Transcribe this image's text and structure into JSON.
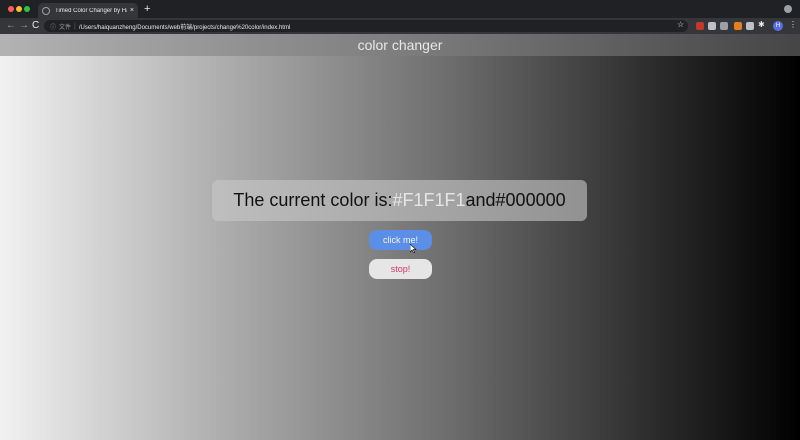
{
  "browser": {
    "tab_title": "Timed Color Changer by Haiq...",
    "tab_close": "×",
    "new_tab": "+",
    "nav": {
      "back": "←",
      "forward": "→",
      "reload": "C"
    },
    "omnibox": {
      "info_icon": "ⓘ",
      "scheme_label": "文件",
      "url": "/Users/haiquanzheng/Documents/web前端/projects/change%20color/index.html"
    },
    "icons": {
      "star": "☆",
      "puzzle": "✱",
      "menu": "⋮"
    },
    "avatar_letter": "H",
    "colors": {
      "traffic_red": "#ff5f57",
      "traffic_yellow": "#febc2e",
      "traffic_green": "#28c840",
      "ext1": "#c0392b",
      "ext2": "#bdc1c6",
      "ext3": "#9aa0a6",
      "ext4": "#e67e22",
      "ext5": "#bdc1c6",
      "avatar": "#5b6ee1"
    }
  },
  "page": {
    "header_title": "color changer",
    "current_color": {
      "prefix": "The current color is: ",
      "color_1": "#F1F1F1",
      "conjunction": " and ",
      "color_2": "#000000"
    },
    "buttons": {
      "click_label": "click me!",
      "stop_label": "stop!"
    },
    "gradient": {
      "from": "#F1F1F1",
      "to": "#000000"
    }
  }
}
